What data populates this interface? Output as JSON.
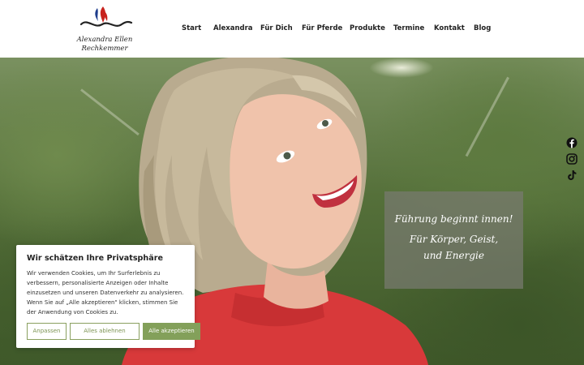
{
  "header": {
    "logo": {
      "name_line1": "Alexandra Ellen",
      "name_line2": "Rechkemmer",
      "icon": "flame-wave-logo-icon",
      "colors": {
        "flame_red": "#c8231e",
        "flame_blue": "#1d3c8c",
        "wave": "#222222"
      }
    },
    "nav": [
      {
        "label": "Start"
      },
      {
        "label": "Alexandra"
      },
      {
        "label": "Für Dich"
      },
      {
        "label": "Für Pferde"
      },
      {
        "label": "Produkte"
      },
      {
        "label": "Termine"
      },
      {
        "label": "Kontakt"
      },
      {
        "label": "Blog"
      }
    ]
  },
  "hero": {
    "tagline": {
      "line1": "Führung beginnt innen!",
      "line2": "Für Körper, Geist,",
      "line3": "und Energie"
    },
    "social": [
      {
        "icon": "facebook-icon"
      },
      {
        "icon": "instagram-icon"
      },
      {
        "icon": "tiktok-icon"
      }
    ]
  },
  "cookie_banner": {
    "title": "Wir schätzen Ihre Privatsphäre",
    "text": "Wir verwenden Cookies, um Ihr Surferlebnis zu verbessern, personalisierte Anzeigen oder Inhalte einzusetzen und unseren Datenverkehr zu analysieren. Wenn Sie auf „Alle akzeptieren\" klicken, stimmen Sie der Anwendung von Cookies zu.",
    "buttons": {
      "customize": "Anpassen",
      "reject": "Alles ablehnen",
      "accept": "Alle akzeptieren"
    },
    "colors": {
      "accent": "#83a05a"
    }
  }
}
